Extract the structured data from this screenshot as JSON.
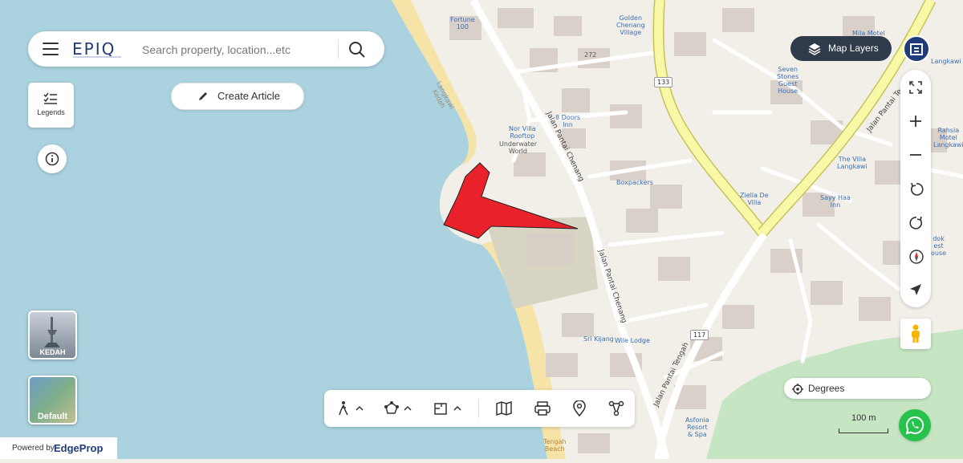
{
  "search": {
    "brand": "EPIQ",
    "placeholder": "Search property, location...etc"
  },
  "actions": {
    "create_article": "Create Article",
    "legends": "Legends"
  },
  "regions": {
    "kedah": "KEDAH",
    "default": "Default"
  },
  "footer": {
    "powered_by": "Powered by",
    "brand": "EdgeProp"
  },
  "top_right": {
    "map_layers": "Map Layers"
  },
  "controls": {
    "degrees": "Degrees",
    "scale": "100 m"
  },
  "map_labels": {
    "fortune": "Fortune\n100",
    "golden_chenang": "Golden\nChenang\nVillage",
    "mila_motel": "Mila Motel",
    "langkawi_tr": "Langkawi",
    "seven_stones": "Seven\nStones\nGuest\nHouse",
    "rahsia": "Rahsia\nMotel\nLangkawi",
    "nor_villa": "Nor Villa\nRooftop",
    "underwater": "Underwater\nWorld",
    "doors_inn": "8 Doors\nInn",
    "boxpackers": "Boxpackers",
    "the_villa": "The Villa\nLangkawi",
    "ziella": "Ziella De\nVilla",
    "sayy_haa": "Sayy Haa\nInn",
    "sri_kijang": "Sri Kijang",
    "wile_lodge": "Wile Lodge",
    "asfonia": "Asfonia\nResort\n& Spa",
    "tengah_beach": "Tengah\nBeach",
    "dok_lest": "dok\nest\nouse",
    "langkawi_kedah": "Langkawi\nKedah"
  },
  "roads": {
    "pantai_chenang_1": "Jalan Pantai Chenang",
    "pantai_chenang_2": "Jalan Pantai Chenang",
    "pantai_tengah": "Jalan Pantai Tengah",
    "pantai_tr": "Jalan Pantai Te",
    "r272": "272",
    "r133": "133",
    "r117": "117"
  },
  "colors": {
    "sea": "#aad3df",
    "land": "#f2efe9",
    "highlight": "#e8212a",
    "accent": "#1f3b79"
  }
}
